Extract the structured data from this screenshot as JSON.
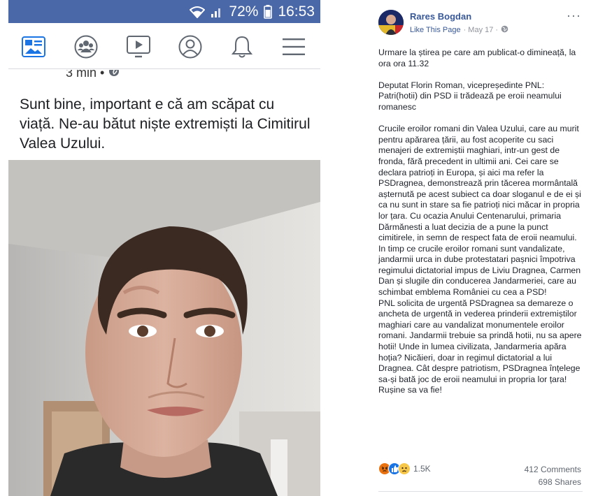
{
  "phone": {
    "status": {
      "battery_percent": "72%",
      "time": "16:53"
    },
    "nav": [
      "news-feed-icon",
      "groups-icon",
      "watch-icon",
      "profile-icon",
      "notifications-icon",
      "menu-icon"
    ],
    "post": {
      "meta": "3 min •",
      "text": "Sunt bine, important e că am scăpat cu viață. Ne-au bătut niște extremiști la Cimitirul Valea Uzului."
    }
  },
  "fb_post": {
    "author": "Rares Bogdan",
    "like_page": "Like This Page",
    "date": "· May 17 ·",
    "more": "···",
    "paragraphs": [
      "Urmare la știrea pe care am publicat-o dimineață, la ora ora 11.32",
      "Deputat Florin Roman, vicepreședinte PNL: Patri(hotii) din PSD ii trădează pe eroii neamului romanesc",
      "Crucile eroilor romani din Valea Uzului, care au murit pentru apărarea țării, au fost acoperite cu saci menajeri de extremiștii maghiari, intr-un gest de fronda, fără precedent in ultimii ani. Cei care se declara patrioți in Europa, și aici ma refer la PSDragnea, demonstrează prin tăcerea mormântală așternută pe acest subiect ca doar sloganul e de ei și ca nu sunt in stare sa fie patrioți nici măcar in propria lor țara. Cu ocazia Anului Centenarului, primaria Dărmănesti a luat decizia de a pune la punct cimitirele, in semn de respect fata de eroii neamului. In timp ce crucile eroilor romani sunt vandalizate, jandarmii urca in dube protestatari pașnici împotriva regimului dictatorial impus de Liviu Dragnea, Carmen Dan și slugile din conducerea Jandarmeriei, care au schimbat emblema României cu cea a PSD!",
      "PNL solicita de urgentă PSDragnea sa demareze o ancheta de urgentă in vederea prinderii extremiștilor maghiari care au vandalizat monumentele eroilor romani. Jandarmii trebuie sa prindă hotii, nu sa apere hotii! Unde in lumea civilizata, Jandarmeria apăra hoția? Nicăieri, doar in regimul dictatorial a lui Dragnea. Cât despre patriotism, PSDragnea înțelege sa-și bată joc de eroii neamului in propria lor țara! Rușine sa va fie!"
    ],
    "reactions": {
      "icons": [
        "angry-icon",
        "like-icon",
        "sad-icon"
      ],
      "count": "1.5K"
    },
    "comments": "412 Comments",
    "shares": "698 Shares"
  },
  "colors": {
    "fb_blue": "#4a67a8",
    "link_blue": "#385898",
    "nav_icon_blue": "#1b74e4",
    "meta_gray": "#90949c",
    "text_dark": "#1d2129"
  }
}
